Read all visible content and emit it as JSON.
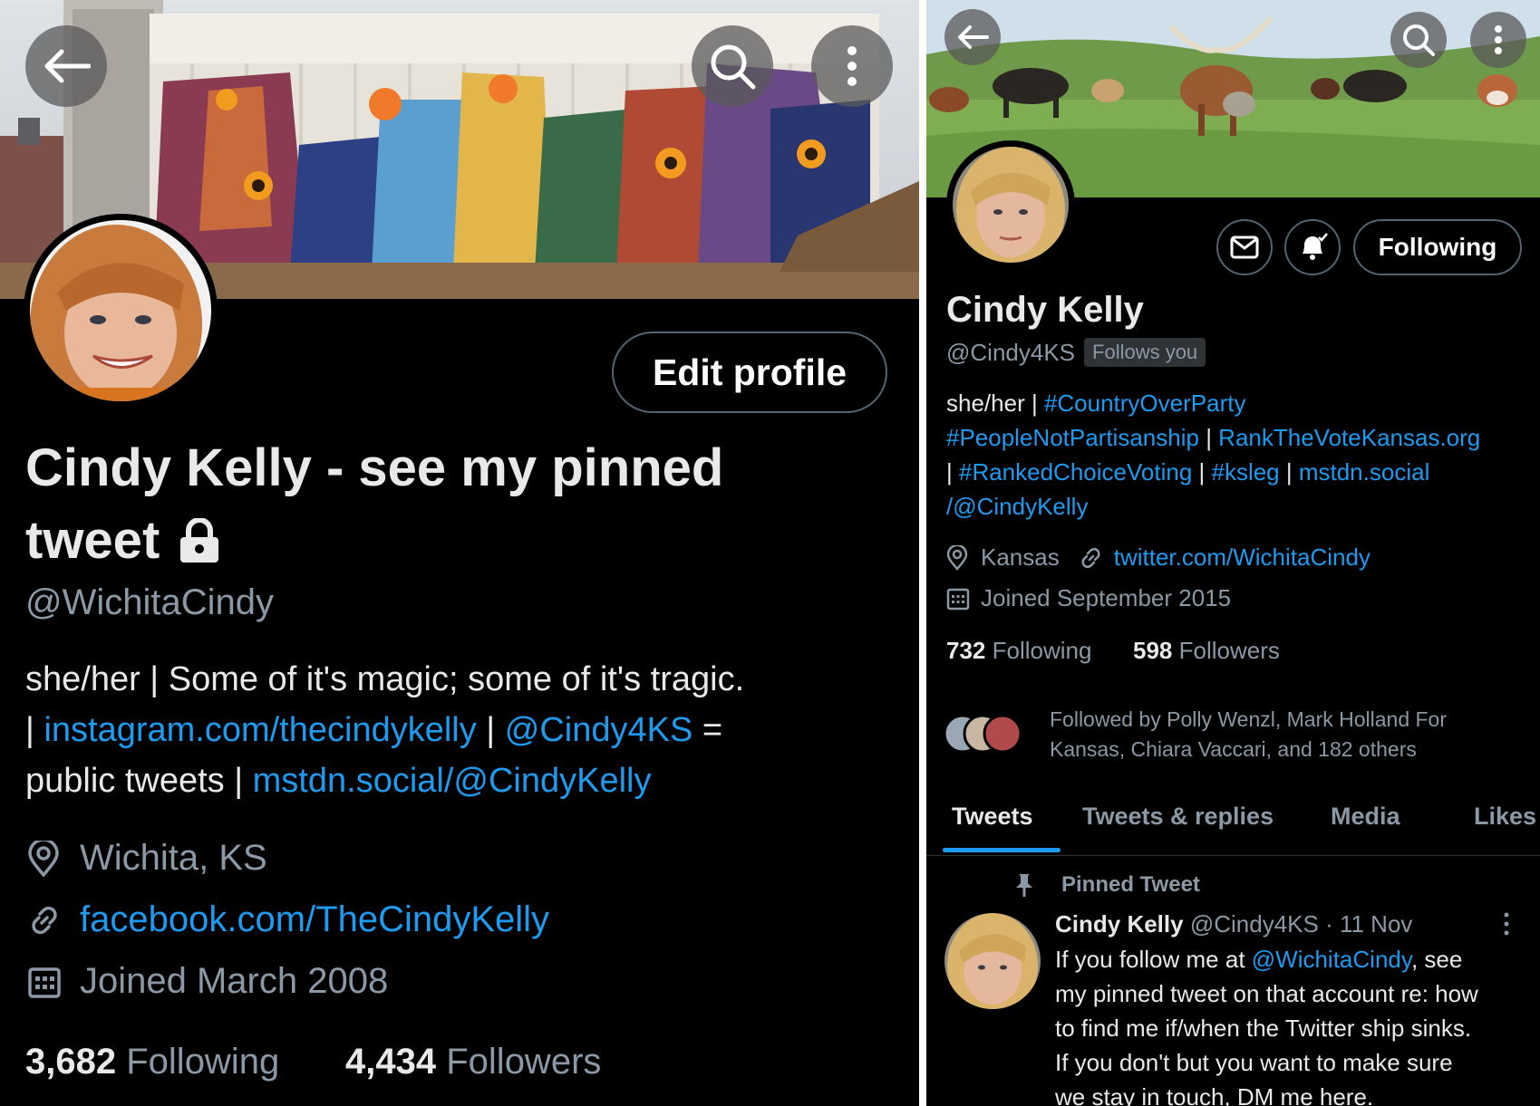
{
  "left_profile": {
    "edit_profile_label": "Edit profile",
    "display_name_line1": "Cindy Kelly - see my pinned",
    "display_name_line2": "tweet",
    "handle": "@WichitaCindy",
    "bio": {
      "line1": "she/her | Some of it's magic; some of it's tragic.",
      "line2_pre": "| ",
      "line2_link1": "instagram.com/thecindykelly",
      "line2_sep": " | ",
      "line2_link2": "@Cindy4KS",
      "line2_post": " =",
      "line3_pre": "public tweets | ",
      "line3_link": "mstdn.social/@CindyKelly"
    },
    "location": "Wichita, KS",
    "website": "facebook.com/TheCindyKelly",
    "joined": "Joined March 2008",
    "following_count": "3,682",
    "following_label": "Following",
    "followers_count": "4,434",
    "followers_label": "Followers"
  },
  "right_profile": {
    "following_button_label": "Following",
    "display_name": "Cindy Kelly",
    "handle": "@Cindy4KS",
    "follows_you_badge": "Follows you",
    "bio": {
      "l1_pre": "she/her | ",
      "l1_link": "#CountryOverParty",
      "l2_link1": "#PeopleNotPartisanship",
      "l2_sep": " | ",
      "l2_link2": "RankTheVoteKansas.org",
      "l3_pre": "| ",
      "l3_link1": "#RankedChoiceVoting",
      "l3_sep1": " | ",
      "l3_link2": "#ksleg",
      "l3_sep2": " | ",
      "l3_link3": "mstdn.social",
      "l4_link": "/@CindyKelly"
    },
    "location": "Kansas",
    "website": "twitter.com/WichitaCindy",
    "joined": "Joined September 2015",
    "following_count": "732",
    "following_label": "Following",
    "followers_count": "598",
    "followers_label": "Followers",
    "followed_by_line1": "Followed by Polly Wenzl, Mark Holland For",
    "followed_by_line2": "Kansas, Chiara Vaccari, and 182 others",
    "tabs": [
      "Tweets",
      "Tweets & replies",
      "Media",
      "Likes"
    ],
    "pinned_tweet": {
      "pinned_label": "Pinned Tweet",
      "author_name": "Cindy Kelly",
      "author_handle": "@Cindy4KS",
      "time": "· 11 Nov",
      "line1_pre": "If you follow me at ",
      "line1_link": "@WichitaCindy",
      "line1_post": ", see",
      "line2": "my pinned tweet on that account re: how",
      "line3": "to find me if/when the Twitter ship sinks.",
      "line4": "If you don't but you want to make sure",
      "line5": "we stay in touch, DM me here."
    }
  },
  "colors": {
    "background": "#000000",
    "link": "#1d9bf0",
    "muted_text": "#8b98a5",
    "divider": "#ffffff"
  },
  "icons": [
    "back-arrow-icon",
    "search-icon",
    "more-vertical-icon",
    "lock-icon",
    "location-pin-icon",
    "link-icon",
    "calendar-icon",
    "mail-icon",
    "bell-plus-icon",
    "pin-icon"
  ]
}
